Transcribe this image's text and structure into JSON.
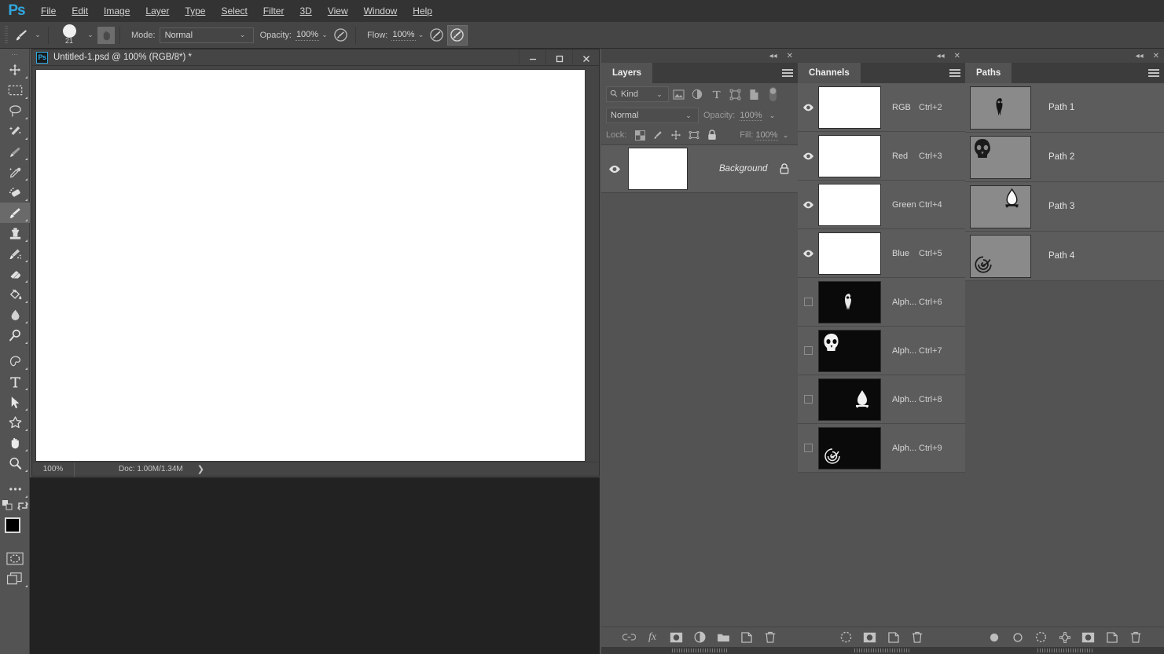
{
  "app": {
    "logo": "Ps",
    "menus": [
      "File",
      "Edit",
      "Image",
      "Layer",
      "Type",
      "Select",
      "Filter",
      "3D",
      "View",
      "Window",
      "Help"
    ]
  },
  "options_bar": {
    "tool_icon": "brush-tool-icon",
    "brush_size": "21",
    "tablet_icon": "tablet-pressure-icon",
    "mode_label": "Mode:",
    "mode_value": "Normal",
    "opacity_label": "Opacity:",
    "opacity_value": "100%",
    "opacity_pressure_icon": "pressure-opacity-icon",
    "flow_label": "Flow:",
    "flow_value": "100%",
    "airbrush_icon": "airbrush-icon",
    "smoothing_icon": "smoothing-icon"
  },
  "toolbar": {
    "tools": [
      {
        "name": "move-tool",
        "glyph": "move"
      },
      {
        "name": "rectangular-marquee-tool",
        "glyph": "marquee"
      },
      {
        "name": "lasso-tool",
        "glyph": "lasso"
      },
      {
        "name": "magic-wand-tool",
        "glyph": "wand"
      },
      {
        "name": "crop-tool",
        "glyph": "crop"
      },
      {
        "name": "eyedropper-tool",
        "glyph": "eyedropper"
      },
      {
        "name": "spot-healing-brush-tool",
        "glyph": "healing"
      },
      {
        "name": "brush-tool",
        "glyph": "brush",
        "selected": true
      },
      {
        "name": "clone-stamp-tool",
        "glyph": "stamp"
      },
      {
        "name": "history-brush-tool",
        "glyph": "historybrush"
      },
      {
        "name": "eraser-tool",
        "glyph": "eraser"
      },
      {
        "name": "gradient-tool",
        "glyph": "bucket"
      },
      {
        "name": "blur-tool",
        "glyph": "blur"
      },
      {
        "name": "dodge-tool",
        "glyph": "dodge"
      },
      {
        "name": "pen-tool",
        "glyph": "pen"
      },
      {
        "name": "type-tool",
        "glyph": "type"
      },
      {
        "name": "path-selection-tool",
        "glyph": "arrow"
      },
      {
        "name": "custom-shape-tool",
        "glyph": "shape"
      },
      {
        "name": "hand-tool",
        "glyph": "hand"
      },
      {
        "name": "zoom-tool",
        "glyph": "zoom"
      },
      {
        "name": "edit-toolbar-tool",
        "glyph": "ellipsis"
      }
    ],
    "foreground_color": "#000000",
    "background_color": "#ffffff",
    "quick_mask_icon": "quick-mask-icon",
    "screen_mode_icon": "screen-mode-icon"
  },
  "document": {
    "title": "Untitled-1.psd @ 100% (RGB/8*) *",
    "icon": "ps-document-icon",
    "window_buttons": {
      "minimize": "minimize-icon",
      "maximize": "maximize-icon",
      "close": "close-icon"
    },
    "status": {
      "zoom": "100%",
      "doc_label": "Doc:",
      "doc_value": "1.00M/1.34M"
    },
    "canvas_color": "#ffffff"
  },
  "layers_panel": {
    "tab": "Layers",
    "filter_placeholder": "Kind",
    "filter_icons": [
      "filter-pixel-icon",
      "filter-adjustment-icon",
      "filter-type-icon",
      "filter-shape-icon",
      "filter-smart-object-icon",
      "filter-toggle-icon"
    ],
    "blend_mode": "Normal",
    "opacity_label": "Opacity:",
    "opacity_value": "100%",
    "lock_label": "Lock:",
    "lock_icons": [
      "lock-transparency-icon",
      "lock-image-icon",
      "lock-position-icon",
      "lock-artboard-icon",
      "lock-all-icon"
    ],
    "fill_label": "Fill:",
    "fill_value": "100%",
    "layers": [
      {
        "name": "Background",
        "visible": true,
        "locked": true,
        "thumb": "#ffffff"
      }
    ],
    "footer_icons": [
      "link-layers-icon",
      "layer-style-fx-icon",
      "add-layer-mask-icon",
      "new-adjustment-layer-icon",
      "new-group-icon",
      "new-layer-icon",
      "delete-layer-icon"
    ]
  },
  "channels_panel": {
    "tab": "Channels",
    "channels": [
      {
        "name": "RGB",
        "shortcut": "Ctrl+2",
        "visible": true,
        "thumb": "#ffffff",
        "art": "none"
      },
      {
        "name": "Red",
        "shortcut": "Ctrl+3",
        "visible": true,
        "thumb": "#ffffff",
        "art": "none"
      },
      {
        "name": "Green",
        "shortcut": "Ctrl+4",
        "visible": true,
        "thumb": "#ffffff",
        "art": "none"
      },
      {
        "name": "Blue",
        "shortcut": "Ctrl+5",
        "visible": true,
        "thumb": "#ffffff",
        "art": "none"
      },
      {
        "name": "Alph...",
        "shortcut": "Ctrl+6",
        "visible": false,
        "thumb": "#0a0a0a",
        "art": "owl"
      },
      {
        "name": "Alph...",
        "shortcut": "Ctrl+7",
        "visible": false,
        "thumb": "#0a0a0a",
        "art": "skull"
      },
      {
        "name": "Alph...",
        "shortcut": "Ctrl+8",
        "visible": false,
        "thumb": "#0a0a0a",
        "art": "flame"
      },
      {
        "name": "Alph...",
        "shortcut": "Ctrl+9",
        "visible": false,
        "thumb": "#0a0a0a",
        "art": "swirl"
      }
    ],
    "footer_icons": [
      "load-channel-as-selection-icon",
      "save-selection-as-channel-icon",
      "new-channel-icon",
      "delete-channel-icon"
    ]
  },
  "paths_panel": {
    "tab": "Paths",
    "paths": [
      {
        "name": "Path 1",
        "art": "owl",
        "pos": "center"
      },
      {
        "name": "Path 2",
        "art": "skull",
        "pos": "topleft"
      },
      {
        "name": "Path 3",
        "art": "flame",
        "pos": "topright"
      },
      {
        "name": "Path 4",
        "art": "swirl",
        "pos": "bottomleft"
      }
    ],
    "footer_icons": [
      "fill-path-icon",
      "stroke-path-icon",
      "load-path-as-selection-icon",
      "make-work-path-icon",
      "add-layer-mask-icon",
      "new-path-icon",
      "delete-path-icon"
    ]
  }
}
